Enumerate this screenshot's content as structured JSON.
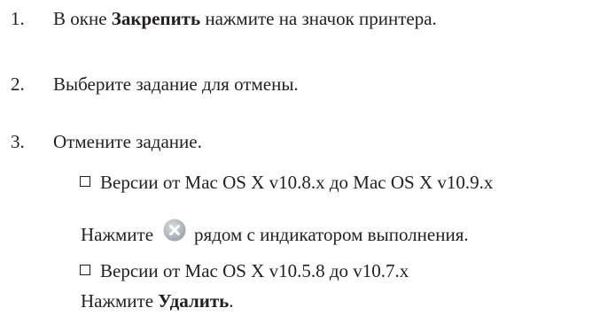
{
  "steps": [
    {
      "number": "1.",
      "text_before": "В окне ",
      "bold": "Закрепить",
      "text_after": " нажмите на значок принтера."
    },
    {
      "number": "2.",
      "text": "Выберите задание для отмены."
    },
    {
      "number": "3.",
      "text": "Отмените задание."
    }
  ],
  "options": [
    {
      "label": "Версии от Mac OS X v10.8.x до Mac OS X v10.9.x",
      "instruction_before": "Нажмите",
      "icon": "cancel-x-icon",
      "instruction_after": "рядом с индикатором выполнения."
    },
    {
      "label": "Версии от Mac OS X v10.5.8 до v10.7.x",
      "instruction_before": "Нажмите ",
      "bold": "Удалить",
      "instruction_after": "."
    }
  ]
}
